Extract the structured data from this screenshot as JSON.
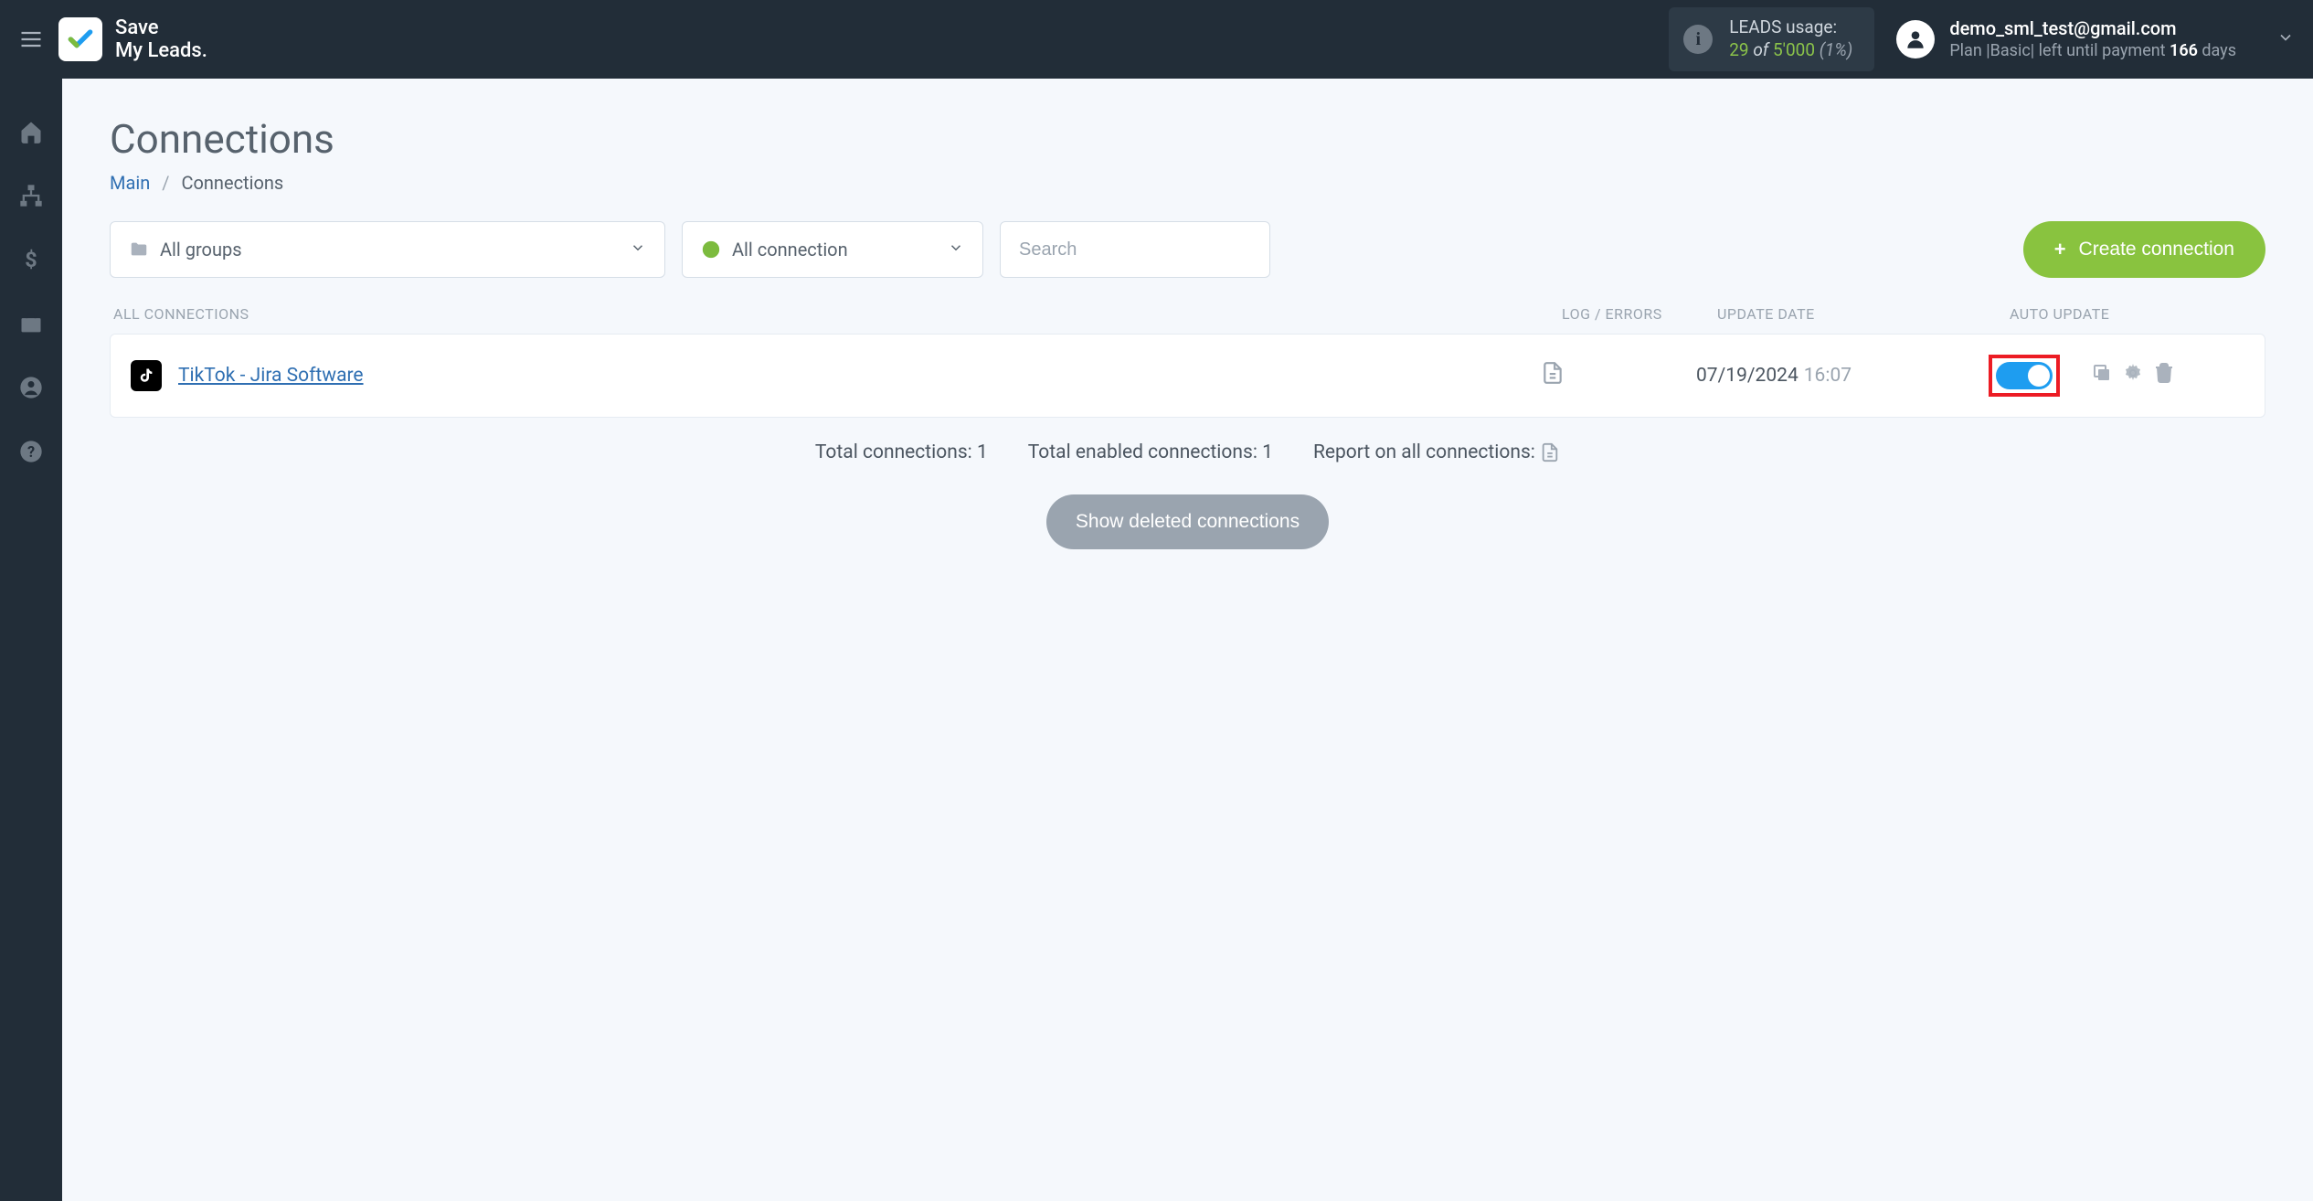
{
  "brand": {
    "line1": "Save",
    "line2": "My Leads."
  },
  "usage": {
    "label": "LEADS usage:",
    "used": "29",
    "of": "of",
    "total": "5'000",
    "pct": "(1%)"
  },
  "account": {
    "email": "demo_sml_test@gmail.com",
    "plan_prefix": "Plan |",
    "plan_name": "Basic",
    "plan_mid": "| left until payment ",
    "days": "166",
    "days_suffix": " days"
  },
  "page": {
    "title": "Connections",
    "crumb_main": "Main",
    "crumb_current": "Connections"
  },
  "filters": {
    "groups_label": "All groups",
    "status_label": "All connection",
    "search_placeholder": "Search",
    "create_label": "Create connection"
  },
  "table": {
    "header_name": "ALL CONNECTIONS",
    "header_log": "LOG / ERRORS",
    "header_date": "UPDATE DATE",
    "header_auto": "AUTO UPDATE"
  },
  "rows": [
    {
      "name": "TikTok - Jira Software",
      "date": "07/19/2024",
      "time": "16:07"
    }
  ],
  "summary": {
    "total_label": "Total connections: ",
    "total_value": "1",
    "enabled_label": "Total enabled connections: ",
    "enabled_value": "1",
    "report_label": "Report on all connections: "
  },
  "buttons": {
    "show_deleted": "Show deleted connections"
  }
}
